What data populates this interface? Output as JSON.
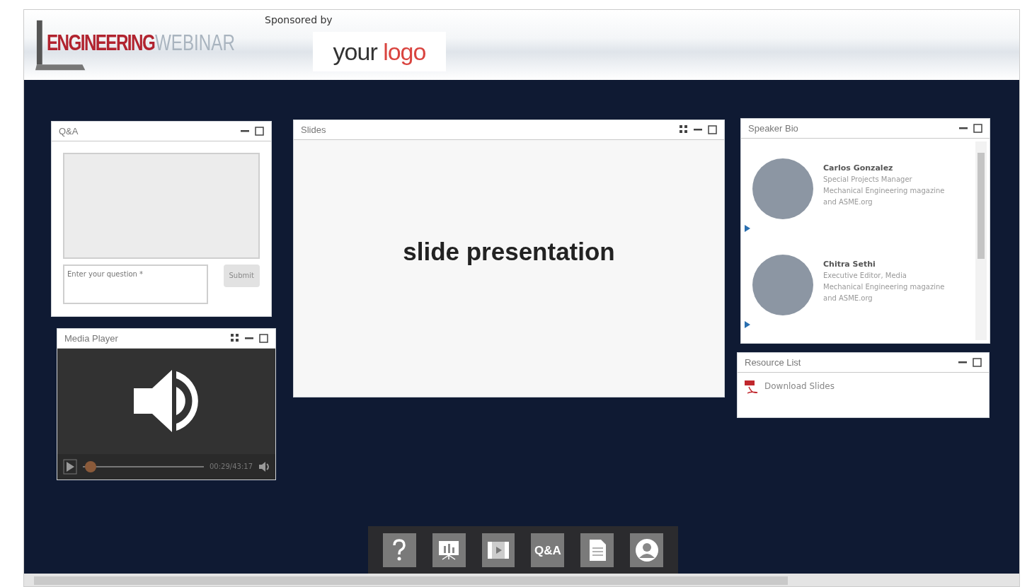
{
  "header": {
    "brand_word_1": "ENGINEERING",
    "brand_word_2": "WEBINAR",
    "sponsored_label": "Sponsored by",
    "sponsor_logo_word_1": "your",
    "sponsor_logo_word_2": "logo"
  },
  "panels": [
    {
      "kind": "qa",
      "title": "Q&A",
      "show_grip": false,
      "question": {
        "placeholder": "Enter your question *"
      },
      "submit": {
        "label": "Submit",
        "disabled": true
      }
    },
    {
      "kind": "media",
      "title": "Media Player",
      "show_grip": true,
      "time": "00:29/43:17",
      "level": 0.02
    },
    {
      "kind": "slides",
      "title": "Slides",
      "show_grip": true,
      "slide_text": "slide presentation"
    },
    {
      "kind": "speakers",
      "title": "Speaker Bio",
      "show_grip": false,
      "speakers": [
        {
          "name": "Carlos Gonzalez",
          "lines": [
            "Special Projects Manager",
            "Mechanical Engineering magazine",
            "and ASME.org"
          ]
        },
        {
          "name": "Chitra Sethi",
          "lines": [
            "Executive Editor, Media",
            "Mechanical Engineering magazine",
            "and ASME.org"
          ]
        }
      ]
    },
    {
      "kind": "resources",
      "title": "Resource List",
      "show_grip": false,
      "resources": [
        {
          "label": "Download Slides"
        }
      ]
    }
  ],
  "toolbar": [
    {
      "kind": "help"
    },
    {
      "kind": "slides"
    },
    {
      "kind": "video"
    },
    {
      "kind": "qa",
      "label": "Q&A"
    },
    {
      "kind": "document"
    },
    {
      "kind": "profile"
    }
  ]
}
